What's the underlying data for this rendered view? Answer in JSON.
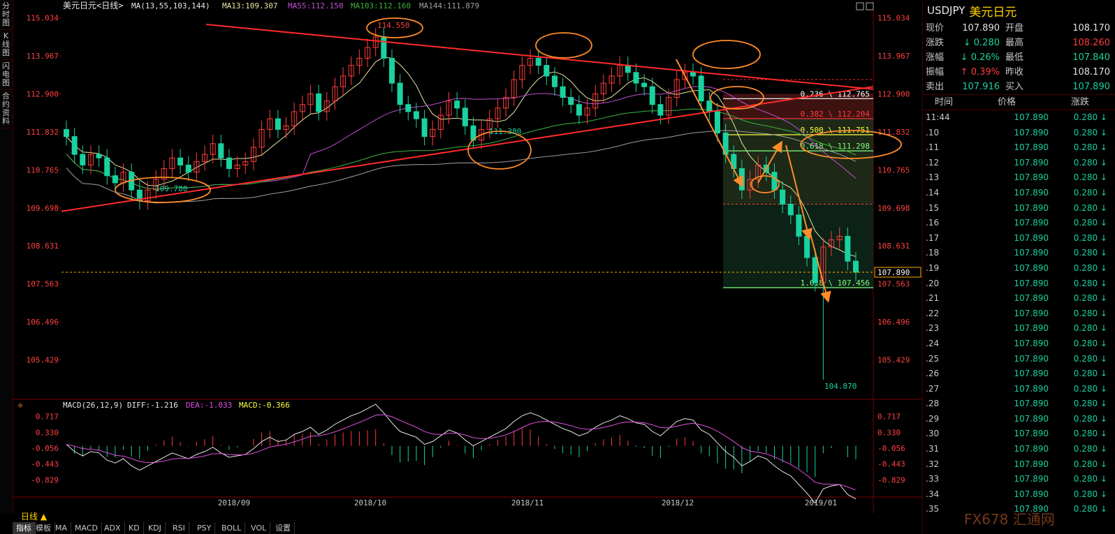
{
  "left_tabs": [
    "分时图",
    "K线图",
    "闪电图",
    "合约资料"
  ],
  "header": {
    "name": "美元日元",
    "period": "日线",
    "ma_label": "MA(13,55,103,144)",
    "ma13": "MA13:109.307",
    "ma55": "MA55:112.150",
    "ma103": "MA103:112.160",
    "ma144": "MA144:111.879"
  },
  "colors": {
    "up": "#ff3c3c",
    "down": "#19d2a0",
    "ma13": "#e6e6a0",
    "ma55": "#c050d0",
    "ma103": "#3cb43c",
    "ma144": "#a0a0a0",
    "trend": "#ff2a2a",
    "orange": "#ff8c28"
  },
  "macd_header": {
    "label": "MACD(26,12,9)",
    "diff": "DIFF:-1.216",
    "dea": "DEA:-1.033",
    "macd": "MACD:-0.366"
  },
  "current_price_tag": "107.890",
  "point_labels": {
    "high": "114.550",
    "low1": "109.780",
    "low2": "111.380",
    "low3": "104.870"
  },
  "fib_levels": [
    {
      "label": "0.236 \\ 112.765",
      "value": 112.765,
      "color": "#ffffff"
    },
    {
      "label": "0.382 \\ 112.204",
      "value": 112.204,
      "color": "#ff3c3c"
    },
    {
      "label": "0.500 \\ 111.751",
      "value": 111.751,
      "color": "#ffff40"
    },
    {
      "label": "0.618 \\ 111.298",
      "value": 111.298,
      "color": "#80ff80"
    },
    {
      "label": "1.618 \\ 107.456",
      "value": 107.456,
      "color": "#80ff80"
    }
  ],
  "chart_data": {
    "type": "candlestick",
    "symbol": "USDJPY",
    "y_ticks": [
      "115.034",
      "113.967",
      "112.900",
      "111.832",
      "110.765",
      "109.698",
      "108.631",
      "107.563",
      "106.496",
      "105.429"
    ],
    "ylim": [
      104.4,
      115.3
    ],
    "x_ticks": [
      "2018/09",
      "2018/10",
      "2018/11",
      "2018/12",
      "2019/01"
    ],
    "macd_ticks": [
      "0.717",
      "0.330",
      "-0.056",
      "-0.443",
      "-0.829"
    ],
    "macd_ylim": [
      -1.25,
      1.0
    ],
    "close": [
      111.7,
      111.2,
      110.9,
      111.2,
      111.1,
      110.6,
      110.4,
      110.7,
      110.2,
      109.9,
      110.2,
      110.5,
      110.8,
      111.1,
      110.9,
      110.7,
      111.0,
      111.2,
      111.5,
      111.1,
      110.8,
      110.9,
      111.0,
      111.4,
      111.9,
      112.2,
      111.9,
      112.0,
      112.4,
      112.6,
      112.9,
      112.4,
      112.7,
      113.1,
      113.4,
      113.7,
      113.9,
      114.2,
      114.5,
      113.9,
      113.2,
      112.6,
      112.4,
      112.2,
      111.7,
      111.9,
      112.3,
      112.7,
      112.5,
      112.0,
      111.6,
      111.9,
      112.2,
      112.5,
      112.8,
      113.3,
      113.7,
      113.9,
      113.7,
      113.4,
      113.1,
      112.8,
      112.6,
      112.3,
      112.5,
      112.9,
      113.2,
      113.4,
      113.7,
      113.5,
      113.2,
      113.1,
      112.6,
      112.3,
      112.8,
      113.3,
      113.5,
      113.4,
      112.7,
      112.4,
      111.8,
      111.2,
      110.8,
      110.2,
      110.5,
      110.9,
      110.7,
      110.2,
      109.8,
      109.5,
      108.9,
      108.3,
      107.6,
      108.6,
      108.8,
      108.9,
      108.2,
      107.89
    ],
    "low_points": {
      "104.870": 93
    },
    "last": 107.89
  }
}
